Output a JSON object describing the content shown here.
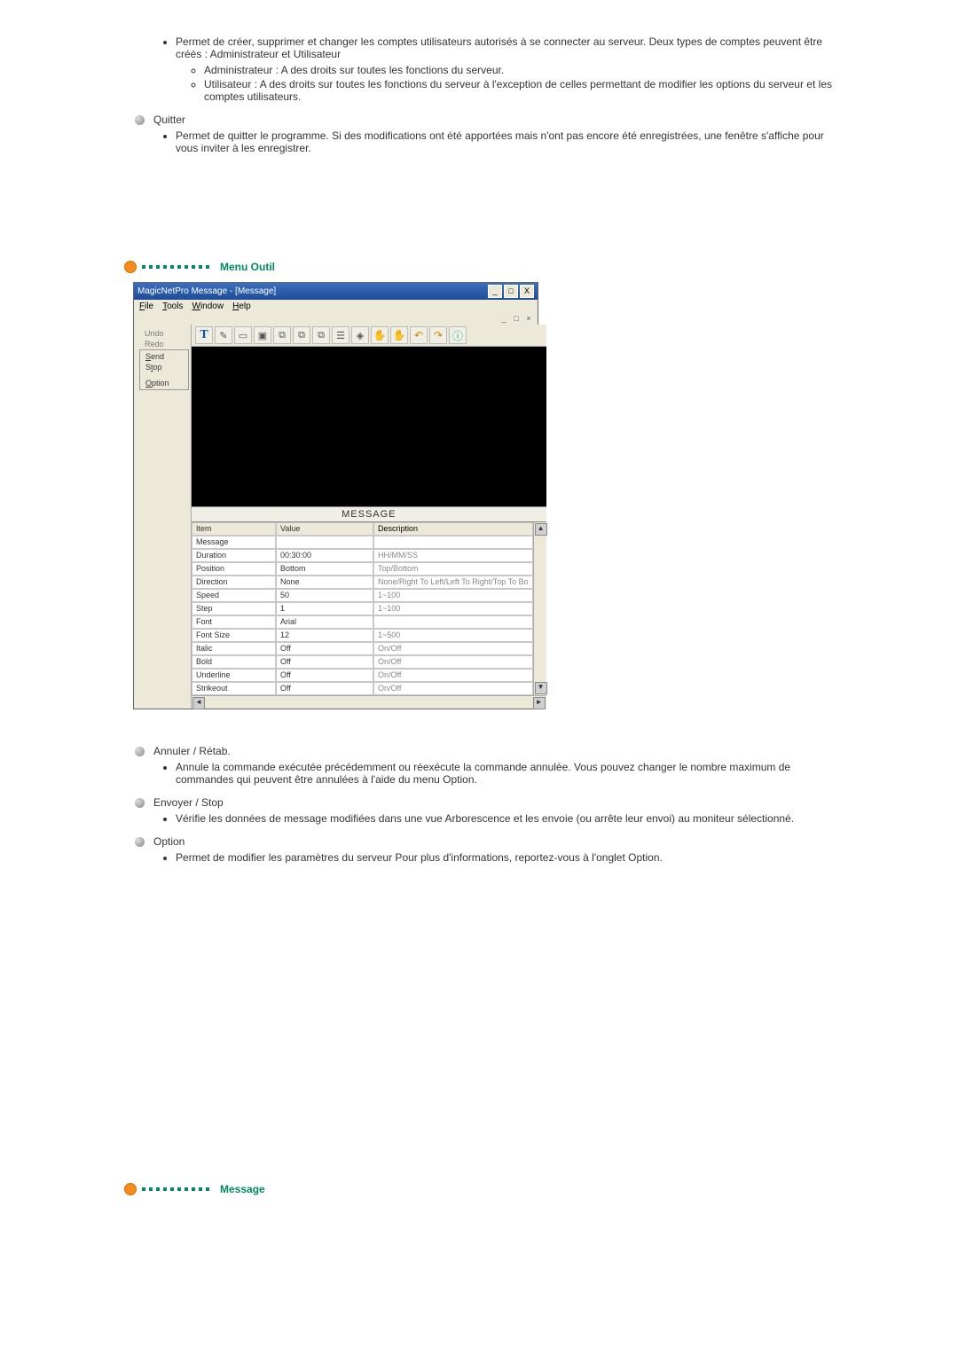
{
  "intro": {
    "main": "Permet de créer, supprimer et changer les comptes utilisateurs autorisés à se connecter au serveur. Deux types de comptes peuvent être créés : Administrateur et Utilisateur",
    "sub": [
      "Administrateur : A des droits sur toutes les fonctions du serveur.",
      "Utilisateur : A des droits sur toutes les fonctions du serveur à l'exception de celles permettant de modifier les options du serveur et les comptes utilisateurs."
    ]
  },
  "quitter": {
    "label": "Quitter",
    "desc": "Permet de quitter le programme. Si des modifications ont été apportées mais n'ont pas encore été enregistrées, une fenêtre s'affiche pour vous inviter à les enregistrer."
  },
  "sections": {
    "menuOutil": "Menu Outil",
    "message": "Message"
  },
  "ss": {
    "title": "MagicNetPro Message - [Message]",
    "min": "_",
    "max": "□",
    "close": "X",
    "doc_min": "_",
    "doc_max": "□",
    "doc_close": "×",
    "menu": {
      "file": "File",
      "tools": "Tools",
      "window": "Window",
      "help": "Help"
    },
    "tree": {
      "undo": "Undo",
      "redo": "Redo",
      "send": "Send",
      "stop": "Stop",
      "option": "Option"
    },
    "dropdown": {
      "send": "Send",
      "stop": "Stop",
      "option": "Option"
    },
    "toolbarT": "T",
    "msgLabel": "MESSAGE",
    "headers": {
      "item": "Item",
      "value": "Value",
      "desc": "Description"
    },
    "rows": [
      {
        "item": "Message",
        "value": "",
        "desc": ""
      },
      {
        "item": "Duration",
        "value": "00:30:00",
        "desc": "HH/MM/SS"
      },
      {
        "item": "Position",
        "value": "Bottom",
        "desc": "Top/Bottom"
      },
      {
        "item": "Direction",
        "value": "None",
        "desc": "None/Right To Left/Left To Right/Top To Bo"
      },
      {
        "item": "Speed",
        "value": "50",
        "desc": "1~100"
      },
      {
        "item": "Step",
        "value": "1",
        "desc": "1~100"
      },
      {
        "item": "Font",
        "value": "Arial",
        "desc": ""
      },
      {
        "item": "Font Size",
        "value": "12",
        "desc": "1~500"
      },
      {
        "item": "Italic",
        "value": "Off",
        "desc": "On/Off"
      },
      {
        "item": "Bold",
        "value": "Off",
        "desc": "On/Off"
      },
      {
        "item": "Underline",
        "value": "Off",
        "desc": "On/Off"
      },
      {
        "item": "Strikeout",
        "value": "Off",
        "desc": "On/Off"
      }
    ],
    "arrows": {
      "up": "▲",
      "down": "▼",
      "left": "◄",
      "right": "►"
    }
  },
  "below": {
    "annuler": {
      "label": "Annuler / Rétab.",
      "desc": "Annule la commande exécutée précédemment ou réexécute la commande annulée. Vous pouvez changer le nombre maximum de commandes qui peuvent être annulées à l'aide du menu Option."
    },
    "envoyer": {
      "label": "Envoyer / Stop",
      "desc": "Vérifie les données de message modifiées dans une vue Arborescence et les envoie (ou arrête leur envoi) au moniteur sélectionné."
    },
    "option": {
      "label": "Option",
      "desc": "Permet de modifier les paramètres du serveur Pour plus d'informations, reportez-vous à l'onglet Option."
    }
  }
}
